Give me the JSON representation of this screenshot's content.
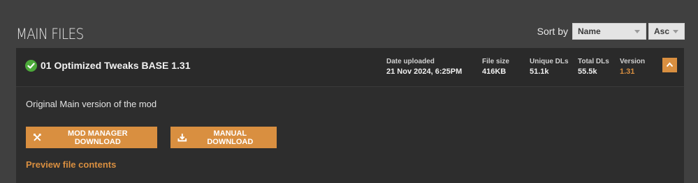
{
  "section": {
    "title": "MAIN FILES"
  },
  "sort": {
    "label": "Sort by",
    "field_selected": "Name",
    "order_selected": "Asc"
  },
  "file": {
    "title": "01 Optimized Tweaks BASE 1.31",
    "stats": {
      "date_uploaded_label": "Date uploaded",
      "date_uploaded": "21 Nov 2024, 6:25PM",
      "file_size_label": "File size",
      "file_size": "416KB",
      "unique_dls_label": "Unique DLs",
      "unique_dls": "51.1k",
      "total_dls_label": "Total DLs",
      "total_dls": "55.5k",
      "version_label": "Version",
      "version": "1.31"
    },
    "description": "Original Main version of the mod",
    "mod_manager_download_label": "MOD MANAGER DOWNLOAD",
    "manual_download_label": "MANUAL DOWNLOAD",
    "preview_link_label": "Preview file contents"
  },
  "colors": {
    "accent": "#d98f40",
    "success": "#4caa3a",
    "background": "#404040",
    "card": "#2d2d2d"
  },
  "icons": {
    "status": "check-circle-icon",
    "collapse": "chevron-up-icon",
    "mod_manager": "tools-icon",
    "manual": "download-icon",
    "select_caret": "caret-down-icon"
  }
}
